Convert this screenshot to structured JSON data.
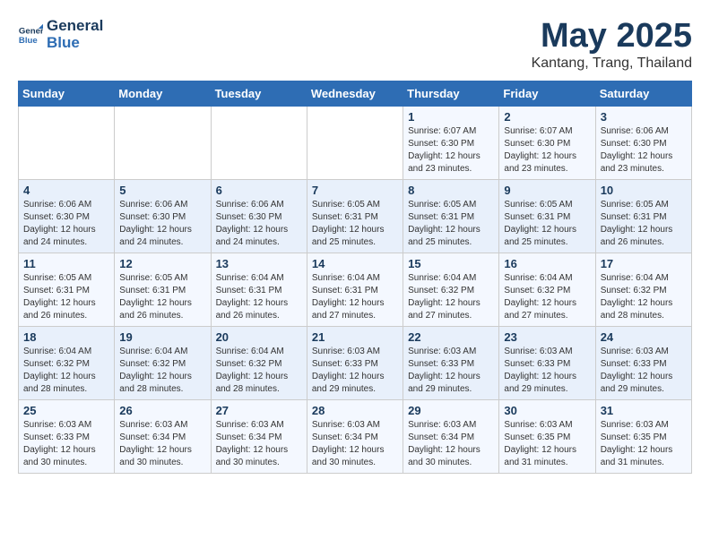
{
  "logo": {
    "line1": "General",
    "line2": "Blue"
  },
  "title": "May 2025",
  "location": "Kantang, Trang, Thailand",
  "weekdays": [
    "Sunday",
    "Monday",
    "Tuesday",
    "Wednesday",
    "Thursday",
    "Friday",
    "Saturday"
  ],
  "weeks": [
    [
      {
        "day": "",
        "info": ""
      },
      {
        "day": "",
        "info": ""
      },
      {
        "day": "",
        "info": ""
      },
      {
        "day": "",
        "info": ""
      },
      {
        "day": "1",
        "info": "Sunrise: 6:07 AM\nSunset: 6:30 PM\nDaylight: 12 hours\nand 23 minutes."
      },
      {
        "day": "2",
        "info": "Sunrise: 6:07 AM\nSunset: 6:30 PM\nDaylight: 12 hours\nand 23 minutes."
      },
      {
        "day": "3",
        "info": "Sunrise: 6:06 AM\nSunset: 6:30 PM\nDaylight: 12 hours\nand 23 minutes."
      }
    ],
    [
      {
        "day": "4",
        "info": "Sunrise: 6:06 AM\nSunset: 6:30 PM\nDaylight: 12 hours\nand 24 minutes."
      },
      {
        "day": "5",
        "info": "Sunrise: 6:06 AM\nSunset: 6:30 PM\nDaylight: 12 hours\nand 24 minutes."
      },
      {
        "day": "6",
        "info": "Sunrise: 6:06 AM\nSunset: 6:30 PM\nDaylight: 12 hours\nand 24 minutes."
      },
      {
        "day": "7",
        "info": "Sunrise: 6:05 AM\nSunset: 6:31 PM\nDaylight: 12 hours\nand 25 minutes."
      },
      {
        "day": "8",
        "info": "Sunrise: 6:05 AM\nSunset: 6:31 PM\nDaylight: 12 hours\nand 25 minutes."
      },
      {
        "day": "9",
        "info": "Sunrise: 6:05 AM\nSunset: 6:31 PM\nDaylight: 12 hours\nand 25 minutes."
      },
      {
        "day": "10",
        "info": "Sunrise: 6:05 AM\nSunset: 6:31 PM\nDaylight: 12 hours\nand 26 minutes."
      }
    ],
    [
      {
        "day": "11",
        "info": "Sunrise: 6:05 AM\nSunset: 6:31 PM\nDaylight: 12 hours\nand 26 minutes."
      },
      {
        "day": "12",
        "info": "Sunrise: 6:05 AM\nSunset: 6:31 PM\nDaylight: 12 hours\nand 26 minutes."
      },
      {
        "day": "13",
        "info": "Sunrise: 6:04 AM\nSunset: 6:31 PM\nDaylight: 12 hours\nand 26 minutes."
      },
      {
        "day": "14",
        "info": "Sunrise: 6:04 AM\nSunset: 6:31 PM\nDaylight: 12 hours\nand 27 minutes."
      },
      {
        "day": "15",
        "info": "Sunrise: 6:04 AM\nSunset: 6:32 PM\nDaylight: 12 hours\nand 27 minutes."
      },
      {
        "day": "16",
        "info": "Sunrise: 6:04 AM\nSunset: 6:32 PM\nDaylight: 12 hours\nand 27 minutes."
      },
      {
        "day": "17",
        "info": "Sunrise: 6:04 AM\nSunset: 6:32 PM\nDaylight: 12 hours\nand 28 minutes."
      }
    ],
    [
      {
        "day": "18",
        "info": "Sunrise: 6:04 AM\nSunset: 6:32 PM\nDaylight: 12 hours\nand 28 minutes."
      },
      {
        "day": "19",
        "info": "Sunrise: 6:04 AM\nSunset: 6:32 PM\nDaylight: 12 hours\nand 28 minutes."
      },
      {
        "day": "20",
        "info": "Sunrise: 6:04 AM\nSunset: 6:32 PM\nDaylight: 12 hours\nand 28 minutes."
      },
      {
        "day": "21",
        "info": "Sunrise: 6:03 AM\nSunset: 6:33 PM\nDaylight: 12 hours\nand 29 minutes."
      },
      {
        "day": "22",
        "info": "Sunrise: 6:03 AM\nSunset: 6:33 PM\nDaylight: 12 hours\nand 29 minutes."
      },
      {
        "day": "23",
        "info": "Sunrise: 6:03 AM\nSunset: 6:33 PM\nDaylight: 12 hours\nand 29 minutes."
      },
      {
        "day": "24",
        "info": "Sunrise: 6:03 AM\nSunset: 6:33 PM\nDaylight: 12 hours\nand 29 minutes."
      }
    ],
    [
      {
        "day": "25",
        "info": "Sunrise: 6:03 AM\nSunset: 6:33 PM\nDaylight: 12 hours\nand 30 minutes."
      },
      {
        "day": "26",
        "info": "Sunrise: 6:03 AM\nSunset: 6:34 PM\nDaylight: 12 hours\nand 30 minutes."
      },
      {
        "day": "27",
        "info": "Sunrise: 6:03 AM\nSunset: 6:34 PM\nDaylight: 12 hours\nand 30 minutes."
      },
      {
        "day": "28",
        "info": "Sunrise: 6:03 AM\nSunset: 6:34 PM\nDaylight: 12 hours\nand 30 minutes."
      },
      {
        "day": "29",
        "info": "Sunrise: 6:03 AM\nSunset: 6:34 PM\nDaylight: 12 hours\nand 30 minutes."
      },
      {
        "day": "30",
        "info": "Sunrise: 6:03 AM\nSunset: 6:35 PM\nDaylight: 12 hours\nand 31 minutes."
      },
      {
        "day": "31",
        "info": "Sunrise: 6:03 AM\nSunset: 6:35 PM\nDaylight: 12 hours\nand 31 minutes."
      }
    ]
  ]
}
